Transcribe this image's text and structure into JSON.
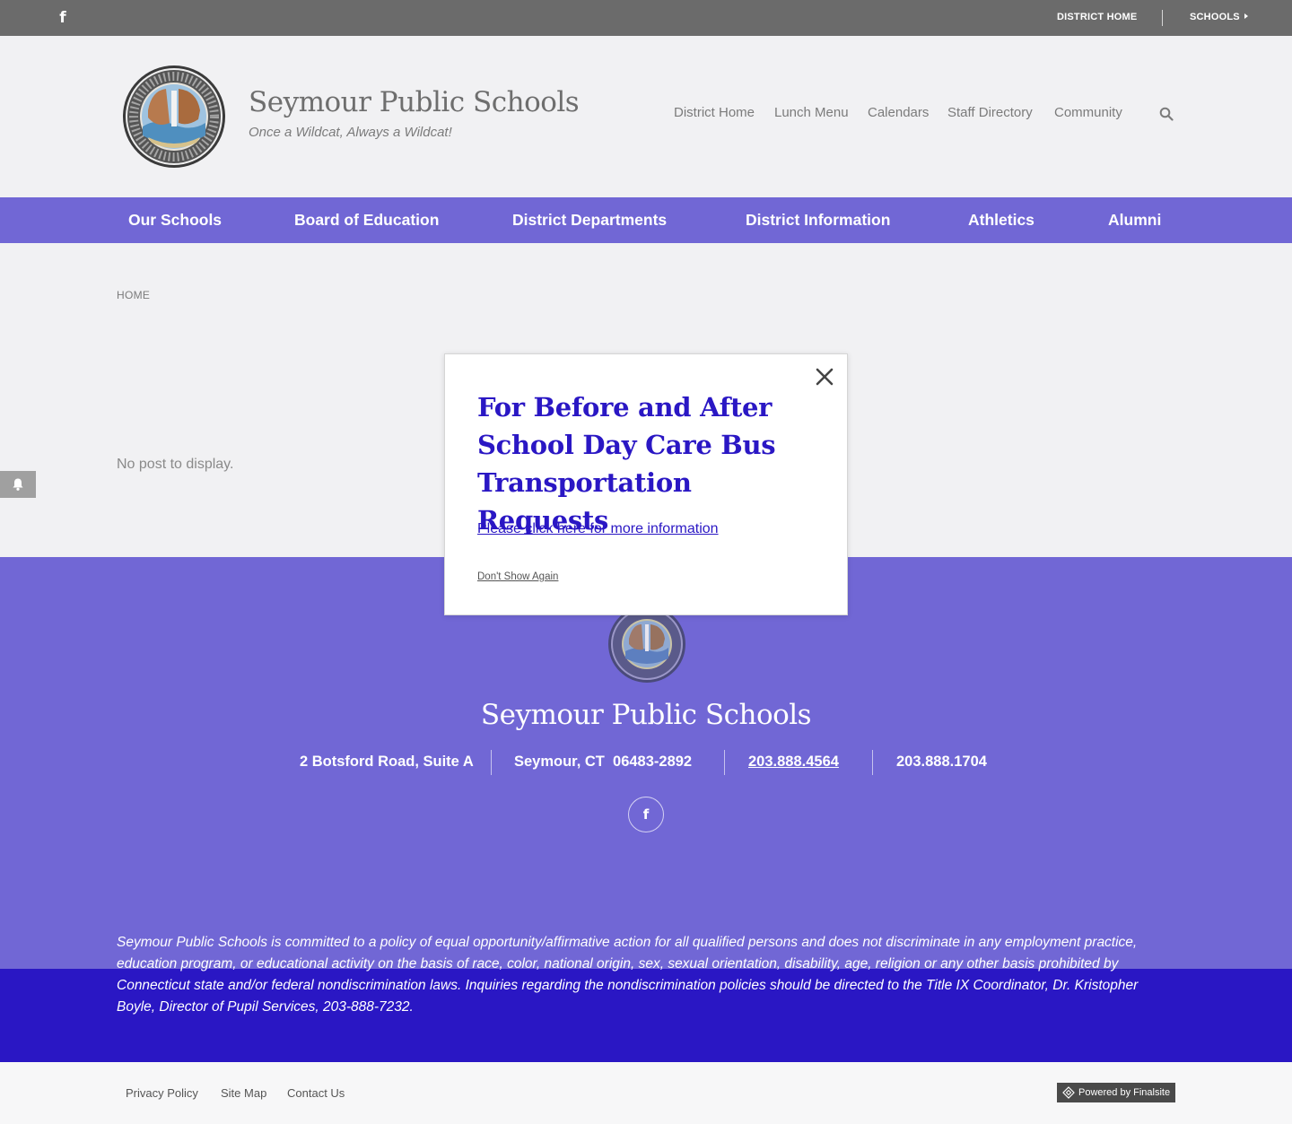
{
  "utility_bar": {
    "facebook_icon": "facebook-icon",
    "district_home": "DISTRICT HOME",
    "schools": "SCHOOLS"
  },
  "header": {
    "site_title": "Seymour Public Schools",
    "tagline": "Once a Wildcat, Always a Wildcat!",
    "logo_icon": "district-seal",
    "quick_links": [
      "District Home",
      "Lunch Menu",
      "Calendars",
      "Staff Directory",
      "Community"
    ],
    "search_icon": "search-icon"
  },
  "main_nav": {
    "items": [
      "Our Schools",
      "Board of Education",
      "District Departments",
      "District Information",
      "Athletics",
      "Alumni"
    ]
  },
  "content": {
    "breadcrumb": "HOME",
    "empty_message": "No post to display.",
    "alert_icon": "bell-icon"
  },
  "modal": {
    "title": "For Before and After School Day Care Bus Transportation Requests",
    "link_text": "Please click here for more information",
    "dismiss_text": "Don't Show Again",
    "close_icon": "close-icon"
  },
  "footer": {
    "title": "Seymour Public Schools",
    "address": "2 Botsford Road, Suite A",
    "city": "Seymour, CT  06483-2892",
    "phone": "203.888.4564",
    "fax": "203.888.1704",
    "facebook_icon": "facebook-icon",
    "policy": "Seymour Public Schools is committed to a policy of equal opportunity/affirmative action for all qualified persons and does not discriminate in any employment practice, education program, or educational activity on the basis of race, color, national origin, sex, sexual orientation, disability, age, religion or any other basis prohibited by Connecticut state and/or federal nondiscrimination laws.  Inquiries regarding the nondiscrimination policies should be directed to the Title IX Coordinator, Dr. Kristopher Boyle, Director of Pupil Services, 203-888-7232."
  },
  "legal": {
    "links": [
      "Privacy Policy",
      "Site Map",
      "Contact Us"
    ],
    "powered_by": "Powered by Finalsite"
  },
  "colors": {
    "nav_purple": "#7167d5",
    "deep_blue": "#2a17c4",
    "utility_gray": "#6b6b6b",
    "background": "#f1f1f3"
  }
}
